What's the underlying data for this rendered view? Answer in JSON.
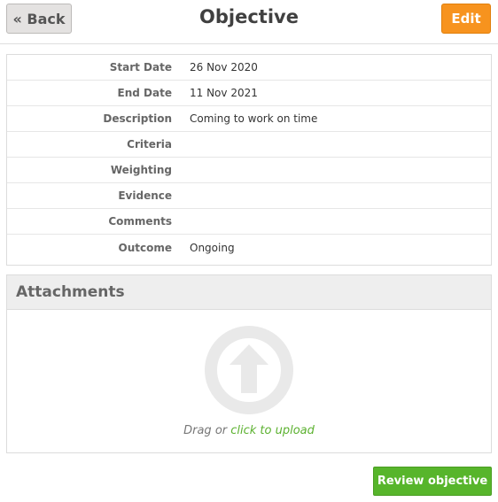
{
  "header": {
    "back_label": "« Back",
    "title": "Objective",
    "edit_label": "Edit"
  },
  "details": [
    {
      "label": "Start Date",
      "value": "26 Nov 2020"
    },
    {
      "label": "End Date",
      "value": "11 Nov 2021"
    },
    {
      "label": "Description",
      "value": "Coming to work on time"
    },
    {
      "label": "Criteria",
      "value": ""
    },
    {
      "label": "Weighting",
      "value": ""
    },
    {
      "label": "Evidence",
      "value": ""
    },
    {
      "label": "Comments",
      "value": ""
    },
    {
      "label": "Outcome",
      "value": "Ongoing"
    }
  ],
  "attachments": {
    "title": "Attachments",
    "drag_text": "Drag or ",
    "upload_link": "click to upload",
    "icon": "upload-arrow-icon"
  },
  "footer": {
    "review_label": "Review objective"
  },
  "colors": {
    "edit": "#f7931e",
    "review": "#57b52b",
    "link": "#5bb12f"
  }
}
